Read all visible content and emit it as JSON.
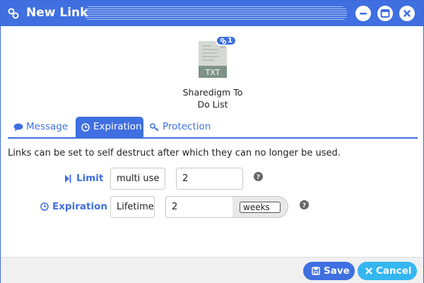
{
  "window": {
    "title": "New Link",
    "title_icon": "link-icon",
    "accent": "#3f6fe0"
  },
  "controls": {
    "minimize": "minimize-icon",
    "maximize": "maximize-icon",
    "close": "close-icon"
  },
  "file": {
    "type_label": "TXT",
    "name_line1": "Sharedigm To",
    "name_line2": "Do List",
    "link_count": "1"
  },
  "tabs": [
    {
      "label": "Message",
      "icon": "comment-icon"
    },
    {
      "label": "Expiration",
      "icon": "clock-icon",
      "active": true
    },
    {
      "label": "Protection",
      "icon": "key-icon"
    }
  ],
  "description": "Links can be set to self destruct after which they can no longer be used.",
  "limit": {
    "label": "Limit",
    "mode": "multi use",
    "count": "2"
  },
  "expiration": {
    "label": "Expiration",
    "mode": "Lifetime",
    "amount": "2",
    "unit": "weeks"
  },
  "footer": {
    "save_label": "Save",
    "cancel_label": "Cancel",
    "save_color": "#3f6fe0",
    "cancel_color": "#34b6f0"
  }
}
